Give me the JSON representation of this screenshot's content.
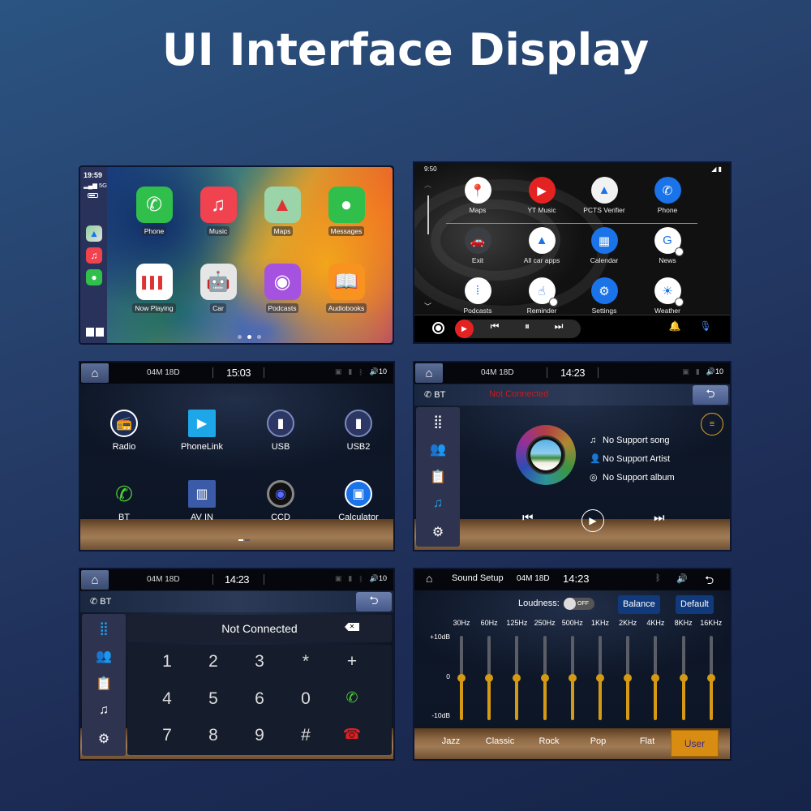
{
  "title": "UI Interface Display",
  "carplay": {
    "time": "19:59",
    "signal": "5G",
    "dock": [
      "maps-icon",
      "music-icon",
      "messages-icon"
    ],
    "apps": [
      {
        "label": "Phone",
        "icon": "phone-icon",
        "glyph": "✆",
        "color": "#2fbf4a"
      },
      {
        "label": "Music",
        "icon": "music-icon",
        "glyph": "♫",
        "color": "#f0424f"
      },
      {
        "label": "Maps",
        "icon": "maps-icon",
        "glyph": "▲",
        "color": "#9bd4a8"
      },
      {
        "label": "Messages",
        "icon": "messages-icon",
        "glyph": "●",
        "color": "#2fbf4a"
      },
      {
        "label": "Now Playing",
        "icon": "now-playing-icon",
        "glyph": "▌▌▌",
        "color": "#ffffff"
      },
      {
        "label": "Car",
        "icon": "car-icon",
        "glyph": "🤖",
        "color": "#e6e6e6"
      },
      {
        "label": "Podcasts",
        "icon": "podcasts-icon",
        "glyph": "◉",
        "color": "#a552e0"
      },
      {
        "label": "Audiobooks",
        "icon": "audiobooks-icon",
        "glyph": "📖",
        "color": "#f7931e"
      }
    ],
    "page_dots": 3,
    "active_page": 2
  },
  "android_auto": {
    "time": "9:50",
    "apps": [
      {
        "label": "Maps",
        "glyph": "📍",
        "bg": "#ffffff"
      },
      {
        "label": "YT Music",
        "glyph": "▶",
        "bg": "#e52222"
      },
      {
        "label": "PCTS Verifier",
        "glyph": "▲",
        "bg": "#f2f2f2"
      },
      {
        "label": "Phone",
        "glyph": "✆",
        "bg": "#1a73e8"
      },
      {
        "label": "Exit",
        "glyph": "🚗",
        "bg": "#3b3f44"
      },
      {
        "label": "All car apps",
        "glyph": "▲",
        "bg": "#ffffff"
      },
      {
        "label": "Calendar",
        "glyph": "▦",
        "bg": "#1a73e8"
      },
      {
        "label": "News",
        "glyph": "G",
        "bg": "#ffffff"
      },
      {
        "label": "Podcasts",
        "glyph": "⁞",
        "bg": "#ffffff"
      },
      {
        "label": "Reminder",
        "glyph": "☝",
        "bg": "#ffffff"
      },
      {
        "label": "Settings",
        "glyph": "⚙",
        "bg": "#1a73e8"
      },
      {
        "label": "Weather",
        "glyph": "☀",
        "bg": "#ffffff"
      }
    ]
  },
  "head_unit": {
    "date": "04M 18D",
    "volume": "10",
    "home_menu": {
      "clock": "15:03",
      "apps": [
        {
          "label": "Radio",
          "glyph": "📻"
        },
        {
          "label": "PhoneLink",
          "glyph": "▶"
        },
        {
          "label": "USB",
          "glyph": "▮"
        },
        {
          "label": "USB2",
          "glyph": "▮"
        },
        {
          "label": "BT",
          "glyph": "✆"
        },
        {
          "label": "AV IN",
          "glyph": "▥"
        },
        {
          "label": "CCD",
          "glyph": "◉"
        },
        {
          "label": "Calculator",
          "glyph": "▣"
        }
      ]
    },
    "bt_music": {
      "clock": "14:23",
      "bt_label": "BT",
      "status": "Not Connected",
      "song": "No Support song",
      "artist": "No Support Artist",
      "album": "No Support album"
    },
    "bt_dialer": {
      "clock": "14:23",
      "bt_label": "BT",
      "status": "Not Connected",
      "keys": [
        "1",
        "2",
        "3",
        "*",
        "+",
        "4",
        "5",
        "6",
        "0",
        "call",
        "7",
        "8",
        "9",
        "#",
        "hangup"
      ]
    },
    "sound_setup": {
      "title": "Sound Setup",
      "clock": "14:23",
      "loudness_label": "Loudness:",
      "loudness_state": "OFF",
      "balance_label": "Balance",
      "default_label": "Default",
      "db_max": "+10dB",
      "db_mid": "0",
      "db_min": "-10dB",
      "bands": [
        {
          "freq": "30Hz",
          "gain_db": 0
        },
        {
          "freq": "60Hz",
          "gain_db": 0
        },
        {
          "freq": "125Hz",
          "gain_db": 0
        },
        {
          "freq": "250Hz",
          "gain_db": 0
        },
        {
          "freq": "500Hz",
          "gain_db": 0
        },
        {
          "freq": "1KHz",
          "gain_db": 0
        },
        {
          "freq": "2KHz",
          "gain_db": 0
        },
        {
          "freq": "4KHz",
          "gain_db": 0
        },
        {
          "freq": "8KHz",
          "gain_db": 0
        },
        {
          "freq": "16KHz",
          "gain_db": 0
        }
      ],
      "presets": [
        "Jazz",
        "Classic",
        "Rock",
        "Pop",
        "Flat",
        "User"
      ],
      "active_preset": "User"
    }
  }
}
